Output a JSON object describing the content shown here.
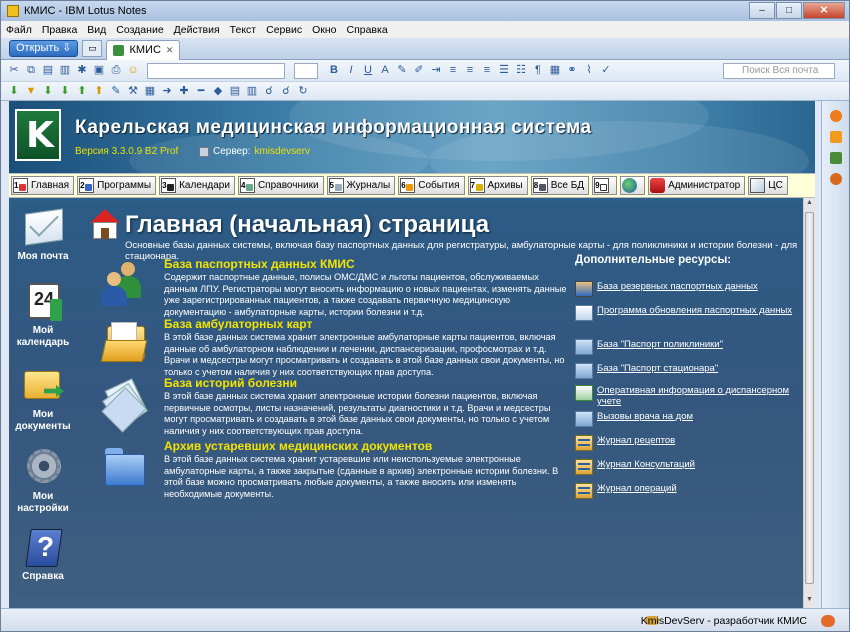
{
  "window": {
    "title": "КМИС - IBM Lotus Notes",
    "minimize": "–",
    "maximize": "□",
    "close": "✕"
  },
  "menu": [
    "Файл",
    "Правка",
    "Вид",
    "Создание",
    "Действия",
    "Текст",
    "Сервис",
    "Окно",
    "Справка"
  ],
  "tabs": {
    "open_button": "Открыть ⇩",
    "active_tab": "КМИС",
    "close_glyph": "✕"
  },
  "toolbar": {
    "search_placeholder": "Поиск Вся почта"
  },
  "banner": {
    "title": "Карельская медицинская информационная система",
    "version": "Версия 3.3.0.9 B2 Prof",
    "server_label": "Сервер:",
    "server_value": "kmisdevserv"
  },
  "nav": [
    {
      "num": "1",
      "label": "Главная"
    },
    {
      "num": "2",
      "label": "Программы"
    },
    {
      "num": "3",
      "label": "Календари"
    },
    {
      "num": "4",
      "label": "Справочники"
    },
    {
      "num": "5",
      "label": "Журналы"
    },
    {
      "num": "6",
      "label": "События"
    },
    {
      "num": "7",
      "label": "Архивы"
    },
    {
      "num": "8",
      "label": "Все БД"
    },
    {
      "num": "9",
      "label": ""
    },
    {
      "num": "",
      "label": ""
    },
    {
      "num": "",
      "label": "Администратор"
    },
    {
      "num": "",
      "label": "ЦС"
    }
  ],
  "sidebar": [
    {
      "label": "Моя почта"
    },
    {
      "label": "Мой календарь"
    },
    {
      "label": "Мои документы"
    },
    {
      "label": "Мои настройки"
    },
    {
      "label": "Справка"
    }
  ],
  "page": {
    "title": "Главная (начальная) страница",
    "subtitle": "Основные базы данных системы, включая базу паспортных данных для регистратуры, амбулаторные карты - для поликлиники и истории болезни - для стационара."
  },
  "databases": [
    {
      "title": "База паспортных данных КМИС",
      "desc": "Содержит паспортные данные, полисы ОМС/ДМС и льготы пациентов, обслуживаемых данным ЛПУ. Регистраторы могут вносить информацию о новых пациентах, изменять данные уже зарегистрированных пациентов, а также создавать первичную медицинскую документацию - амбулаторные карты, истории болезни и т.д."
    },
    {
      "title": "База амбулаторных карт",
      "desc": "В этой базе данных система хранит электронные амбулаторные карты пациентов, включая данные об амбулаторном наблюдении и лечении, диспансеризации, профосмотрах и т.д. Врачи и медсестры могут просматривать и создавать в этой базе данных свои документы, но только с учетом наличия у них соответствующих прав доступа."
    },
    {
      "title": "База историй болезни",
      "desc": "В этой базе данных система хранит электронные истории болезни пациентов, включая первичные осмотры, листы назначений, результаты диагностики и т.д. Врачи и медсестры могут просматривать и создавать в этой базе данных свои документы, но только с учетом наличия у них соответствующих прав доступа."
    },
    {
      "title": "Архив устаревших медицинских документов",
      "desc": "В этой базе данных система хранит устаревшие или неиспользуемые электронные амбулаторные карты, а также закрытые (сданные в архив) электронные истории болезни. В этой базе можно просматривать любые документы, а также вносить или изменять необходимые документы."
    }
  ],
  "additional": {
    "header": "Дополнительные ресурсы:",
    "items": [
      "База резервных паспортных данных",
      "Программа обновления паспортных данных",
      "База \"Паспорт поликлиники\"",
      "База \"Паспорт стационара\"",
      "Оперативная информация о диспансерном учете",
      "Вызовы врача на дом",
      "Журнал рецептов",
      "Журнал Консультаций",
      "Журнал операций"
    ]
  },
  "status": {
    "text": "KmisDevServ - разработчик КМИС"
  }
}
